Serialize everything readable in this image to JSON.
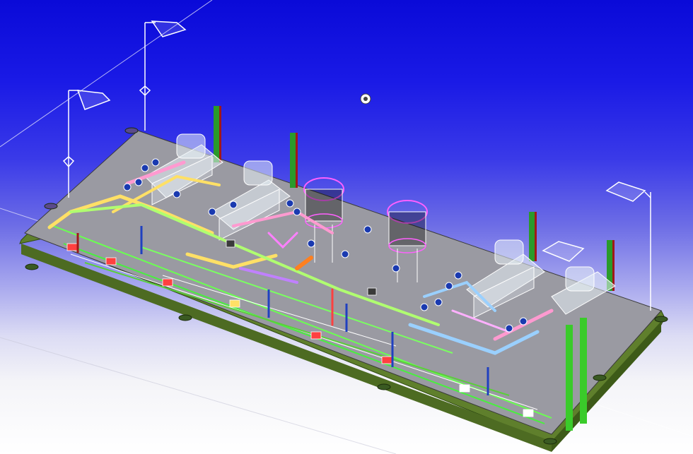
{
  "viewport": {
    "background_top": "#0a0ad8",
    "background_bottom": "#ffffff",
    "ground_line_color": "#ffffff"
  },
  "model": {
    "deck_color": "#9a9aa2",
    "deck_edge_color": "#5a7a2a",
    "frame_color": "#6b8a35",
    "pump_skid_color": "#e8f0f6",
    "strainer_color": "#ff60ff",
    "pipe_colors": [
      "#ffe066",
      "#80ff60",
      "#ff9ad0",
      "#9ad0ff",
      "#ff8020",
      "#c080ff",
      "#ffffff"
    ],
    "column_colors": [
      "#2a9a2a",
      "#a01818"
    ],
    "valve_badge_color": "#1a3ab0"
  },
  "view_cube": {
    "icon": "orbit-center-icon"
  }
}
